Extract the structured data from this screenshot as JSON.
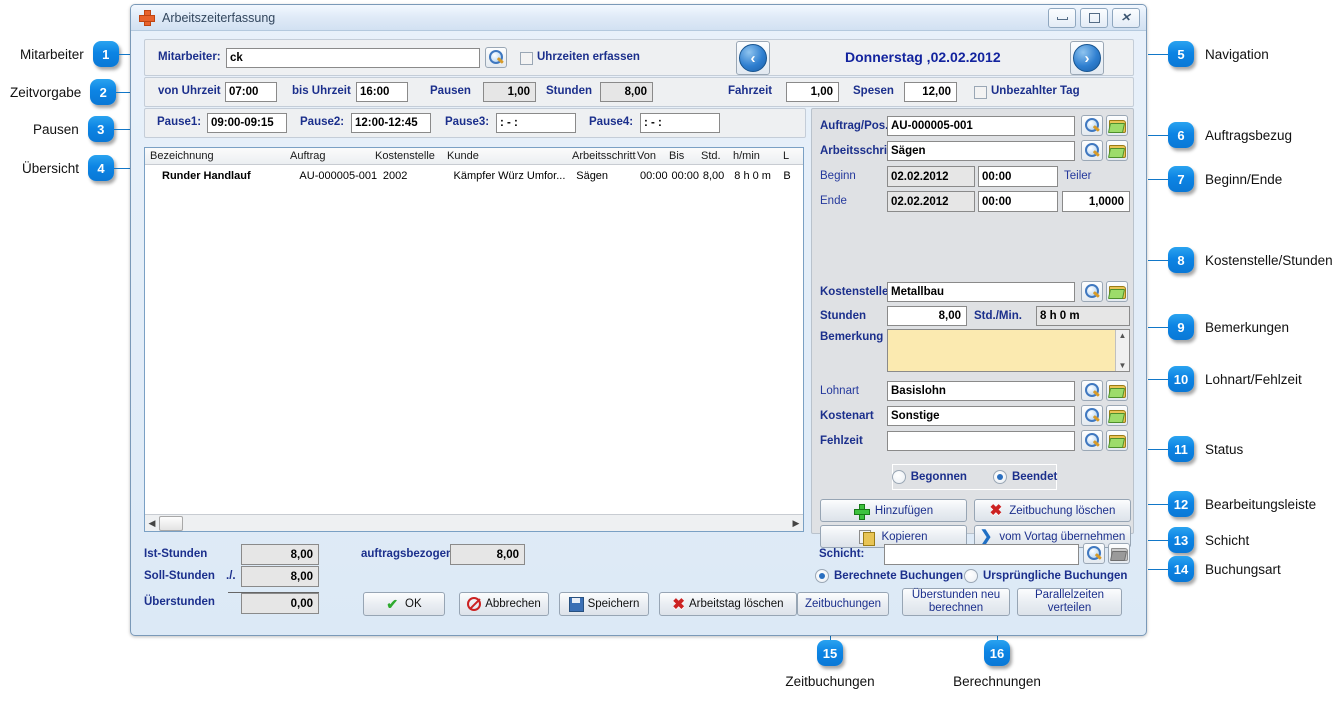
{
  "window": {
    "title": "Arbeitszeiterfassung",
    "icon": "plus-icon",
    "buttons": {
      "minimize": "minimize-icon",
      "maximize": "maximize-icon",
      "close": "close-icon"
    }
  },
  "employee": {
    "label": "Mitarbeiter:",
    "value": "ck",
    "placeholder": "",
    "search_icon": "magnifier-icon"
  },
  "capture_times": {
    "label": "Uhrzeiten erfassen",
    "checked": false
  },
  "navigation": {
    "prev": "arrow-left-icon",
    "next": "arrow-right-icon",
    "date": "Donnerstag ,02.02.2012"
  },
  "timebar": {
    "from_label": "von Uhrzeit",
    "from_value": "07:00",
    "to_label": "bis Uhrzeit",
    "to_value": "16:00",
    "breaks_label": "Pausen",
    "breaks_value": "1,00",
    "hours_label": "Stunden",
    "hours_value": "8,00",
    "travel_label": "Fahrzeit",
    "travel_value": "1,00",
    "expenses_label": "Spesen",
    "expenses_value": "12,00",
    "unpaid_label": "Unbezahlter Tag",
    "unpaid_checked": false
  },
  "breaks": [
    {
      "label": "Pause1:",
      "value": "09:00-09:15"
    },
    {
      "label": "Pause2:",
      "value": "12:00-12:45"
    },
    {
      "label": "Pause3:",
      "value": ":  -  :"
    },
    {
      "label": "Pause4:",
      "value": ":  -  :"
    }
  ],
  "grid": {
    "columns": [
      "Bezeichnung",
      "Auftrag",
      "Kostenstelle",
      "Kunde",
      "Arbeitsschritt",
      "Von",
      "Bis",
      "Std.",
      "h/min",
      "L"
    ],
    "rows": [
      [
        "Runder Handlauf",
        "AU-000005-001",
        "2002",
        "Kämpfer Würz Umfor...",
        "Sägen",
        "00:00",
        "00:00",
        "8,00",
        "8 h 0 m",
        "B"
      ]
    ],
    "hscroll": {
      "left_arrow": "chevron-left-icon",
      "right_arrow": "chevron-right-icon"
    }
  },
  "order": {
    "order_label": "Auftrag/Pos.",
    "order_value": "AU-000005-001",
    "step_label": "Arbeitsschritt",
    "step_value": "Sägen",
    "begin_label": "Beginn",
    "begin_date": "02.02.2012",
    "begin_time": "00:00",
    "end_label": "Ende",
    "end_date": "02.02.2012",
    "end_time": "00:00",
    "divider_label": "Teiler",
    "divider_value": "1,0000"
  },
  "costcenter": {
    "cc_label": "Kostenstelle",
    "cc_value": "Metallbau",
    "hours_label": "Stunden",
    "hours_value": "8,00",
    "hm_label": "Std./Min.",
    "hm_value": "8 h 0 m",
    "remark_label": "Bemerkung",
    "remark_value": "",
    "wagetype_label": "Lohnart",
    "wagetype_value": "Basislohn",
    "costtype_label": "Kostenart",
    "costtype_value": "Sonstige",
    "absence_label": "Fehlzeit",
    "absence_value": ""
  },
  "status": {
    "started_label": "Begonnen",
    "started_selected": false,
    "finished_label": "Beendet",
    "finished_selected": true
  },
  "actions": {
    "add": "Hinzufügen",
    "delete_booking": "Zeitbuchung löschen",
    "copy": "Kopieren",
    "take_previous": "vom Vortag übernehmen"
  },
  "shift": {
    "label": "Schicht:",
    "value": "",
    "search_icon": "magnifier-icon",
    "folder_icon": "folder-icon"
  },
  "booking_type": {
    "calculated_label": "Berechnete Buchungen",
    "calculated_selected": true,
    "original_label": "Ursprüngliche Buchungen",
    "original_selected": false
  },
  "summary": {
    "actual_label": "Ist-Stunden",
    "actual_value": "8,00",
    "target_label": "Soll-Stunden",
    "target_value": "8,00",
    "minus_sign": "./.",
    "overtime_label": "Überstunden",
    "overtime_value": "0,00",
    "order_related_label": "auftragsbezogen",
    "order_related_value": "8,00"
  },
  "footer": {
    "ok": "OK",
    "cancel": "Abbrechen",
    "save": "Speichern",
    "delete_day": "Arbeitstag löschen",
    "bookings": "Zeitbuchungen",
    "recalc_overtime_line1": "Überstunden neu",
    "recalc_overtime_line2": "berechnen",
    "parallel_line1": "Parallelzeiten",
    "parallel_line2": "verteilen"
  },
  "annotations": {
    "left": [
      {
        "num": "1",
        "text": "Mitarbeiter"
      },
      {
        "num": "2",
        "text": "Zeitvorgabe"
      },
      {
        "num": "3",
        "text": "Pausen"
      },
      {
        "num": "4",
        "text": "Übersicht"
      }
    ],
    "right": [
      {
        "num": "5",
        "text": "Navigation"
      },
      {
        "num": "6",
        "text": "Auftragsbezug"
      },
      {
        "num": "7",
        "text": "Beginn/Ende"
      },
      {
        "num": "8",
        "text": "Kostenstelle/Stunden"
      },
      {
        "num": "9",
        "text": "Bemerkungen"
      },
      {
        "num": "10",
        "text": "Lohnart/Fehlzeit"
      },
      {
        "num": "11",
        "text": "Status"
      },
      {
        "num": "12",
        "text": "Bearbeitungsleiste"
      },
      {
        "num": "13",
        "text": "Schicht"
      },
      {
        "num": "14",
        "text": "Buchungsart"
      }
    ],
    "bottom": [
      {
        "num": "15",
        "text": "Zeitbuchungen"
      },
      {
        "num": "16",
        "text": "Berechnungen"
      }
    ]
  },
  "colors": {
    "accent": "#0c84e4",
    "label": "#1b2f8c",
    "memo": "#fbeab0",
    "window_bg": "#dce9f6"
  }
}
